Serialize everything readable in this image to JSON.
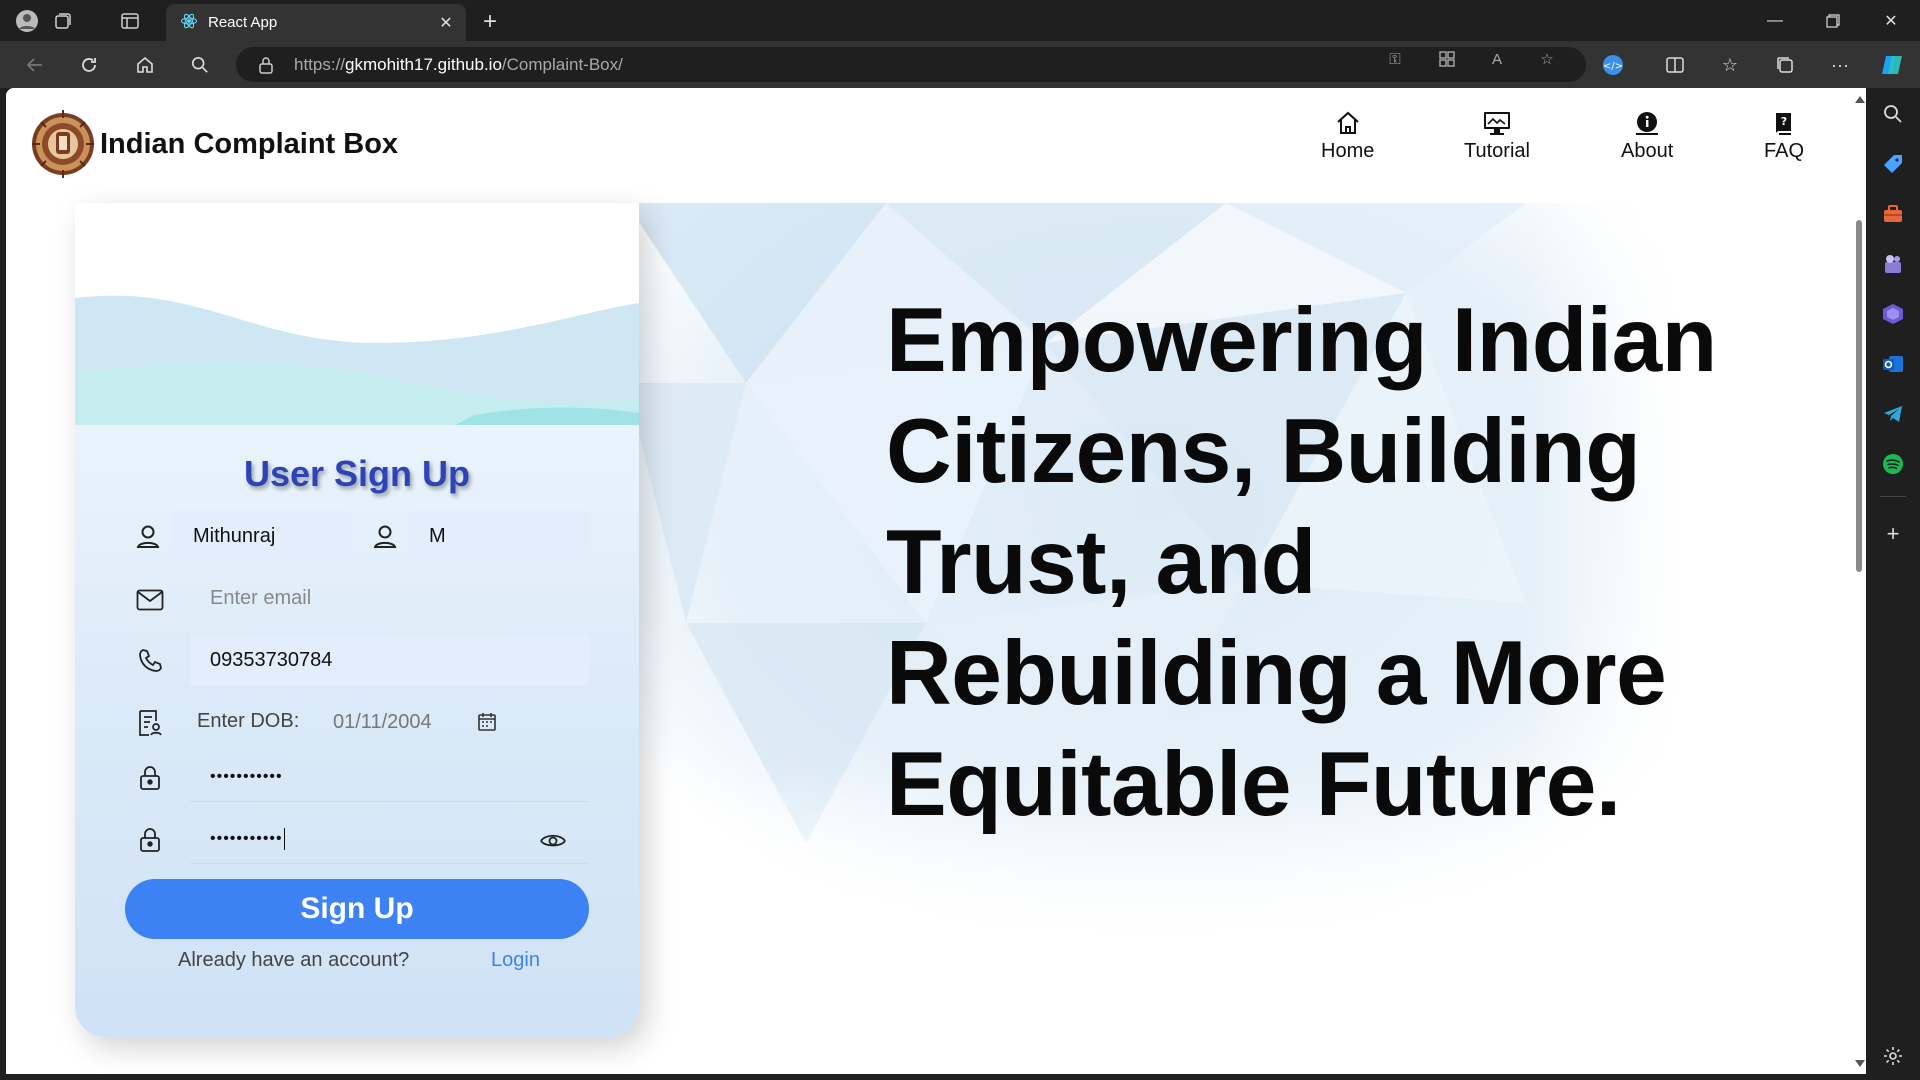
{
  "browser": {
    "tab_title": "React App",
    "url_prefix": "https://",
    "url_host": "gkmohith17.github.io",
    "url_path": "/Complaint-Box/"
  },
  "app": {
    "brand": "Indian Complaint Box",
    "nav": [
      {
        "label": "Home",
        "icon": "home-icon"
      },
      {
        "label": "Tutorial",
        "icon": "monitor-icon"
      },
      {
        "label": "About",
        "icon": "info-icon"
      },
      {
        "label": "FAQ",
        "icon": "question-book-icon"
      }
    ]
  },
  "hero": {
    "lines": [
      "Empowering Indian",
      "Citizens, Building",
      "Trust, and",
      "Rebuilding a More",
      "Equitable Future."
    ]
  },
  "signup": {
    "title": "User Sign Up",
    "first_name": "Mithunraj",
    "last_name": "M",
    "email_placeholder": "Enter email",
    "phone": "09353730784",
    "dob_label": "Enter DOB:",
    "dob_value": "01/11/2004",
    "password": "•••••••••••",
    "confirm_password": "•••••••••••",
    "submit_label": "Sign Up",
    "have_account": "Already have an account?",
    "login_label": "Login"
  },
  "colors": {
    "primary_button": "#3c82f4",
    "title": "#2d43b6",
    "browser_frame": "#1f1f1f"
  }
}
